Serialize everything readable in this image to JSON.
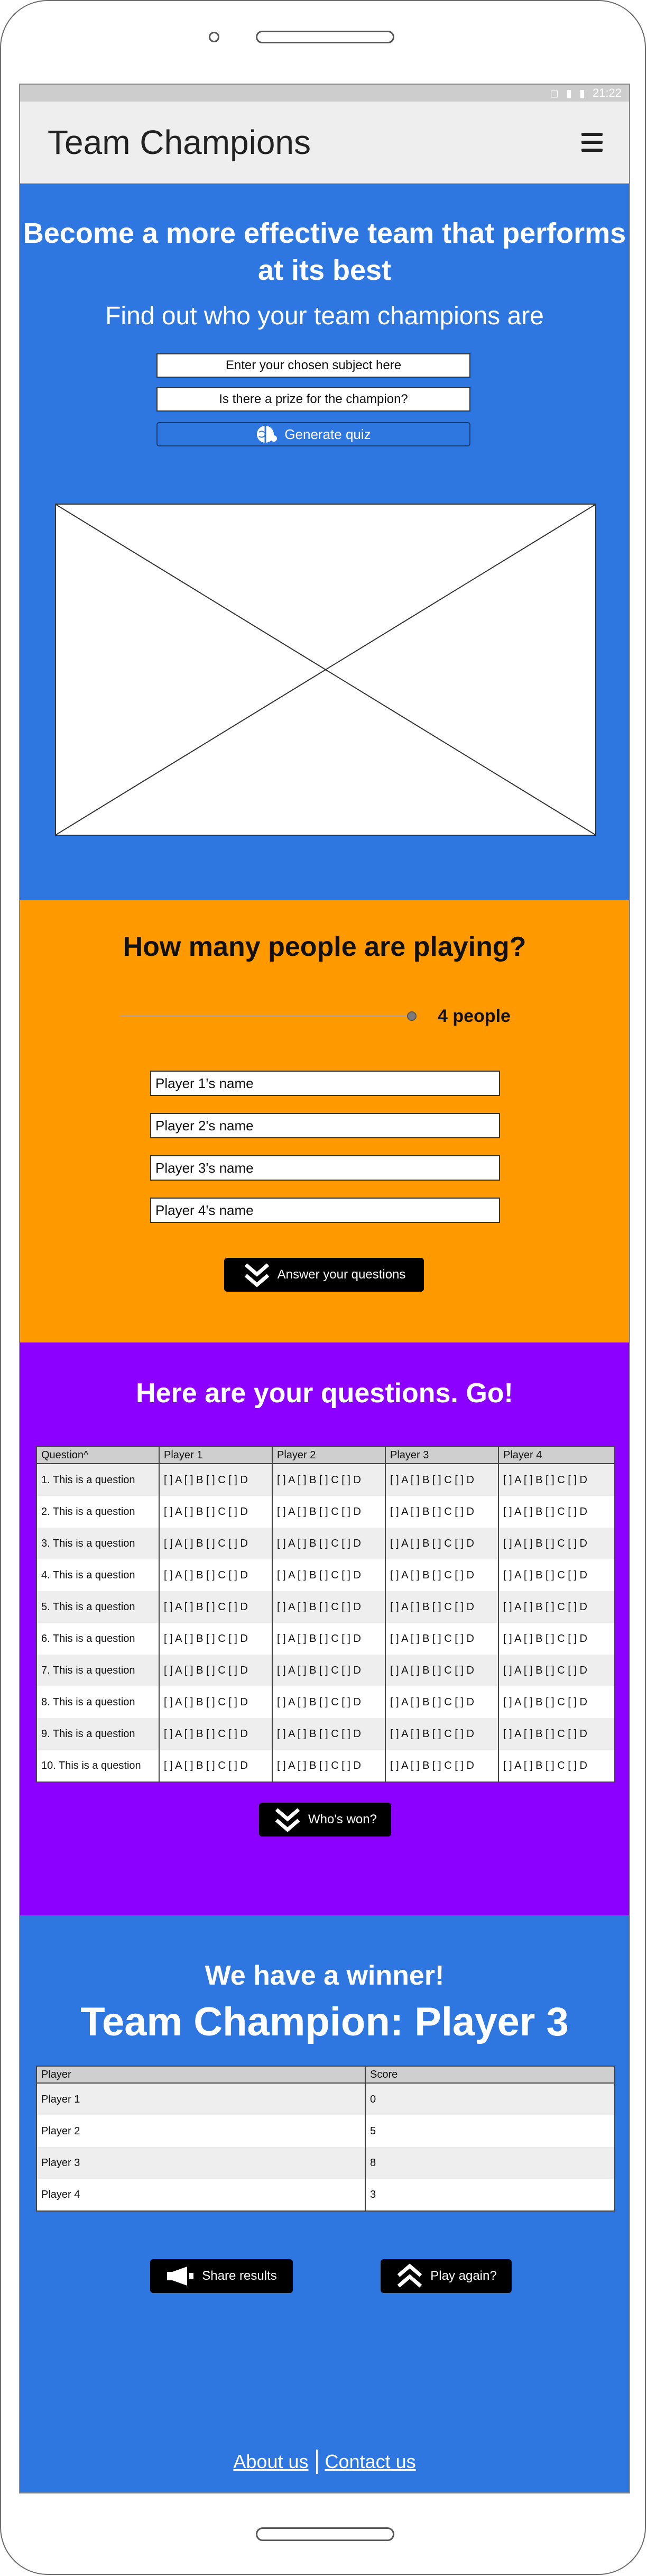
{
  "status_bar": {
    "time": "21:22"
  },
  "header": {
    "title": "Team Champions"
  },
  "hero": {
    "title": "Become a more effective team that performs at its best",
    "subtitle": "Find out who your team champions are",
    "subject_placeholder": "Enter your chosen subject here",
    "prize_placeholder": "Is there a prize for the champion?",
    "generate_label": "Generate quiz"
  },
  "players_section": {
    "title": "How many people are playing?",
    "people_count": "4 people",
    "slider_value": 4,
    "slider_max": 4,
    "name_placeholders": [
      "Player 1's name",
      "Player 2's name",
      "Player 3's name",
      "Player 4's name"
    ],
    "answer_label": "Answer your questions"
  },
  "questions_section": {
    "title": "Here are your questions. Go!",
    "headers": [
      "Question^",
      "Player 1",
      "Player 2",
      "Player 3",
      "Player 4"
    ],
    "rows": [
      [
        "1. This is a question",
        "[ ] A [ ] B [ ] C [ ] D",
        "[ ] A [ ] B [ ] C [ ] D",
        "[ ] A [ ] B [ ] C [ ] D",
        "[ ] A [ ] B [ ] C [ ] D"
      ],
      [
        "2. This is a question",
        "[ ] A [ ] B [ ] C [ ] D",
        "[ ] A [ ] B [ ] C [ ] D",
        "[ ] A [ ] B [ ] C [ ] D",
        "[ ] A [ ] B [ ] C [ ] D"
      ],
      [
        "3. This is a question",
        "[ ] A [ ] B [ ] C [ ] D",
        "[ ] A [ ] B [ ] C [ ] D",
        "[ ] A [ ] B [ ] C [ ] D",
        "[ ] A [ ] B [ ] C [ ] D"
      ],
      [
        "4. This is a question",
        "[ ] A [ ] B [ ] C [ ] D",
        "[ ] A [ ] B [ ] C [ ] D",
        "[ ] A [ ] B [ ] C [ ] D",
        "[ ] A [ ] B [ ] C [ ] D"
      ],
      [
        "5. This is a question",
        "[ ] A [ ] B [ ] C [ ] D",
        "[ ] A [ ] B [ ] C [ ] D",
        "[ ] A [ ] B [ ] C [ ] D",
        "[ ] A [ ] B [ ] C [ ] D"
      ],
      [
        "6. This is a question",
        "[ ] A [ ] B [ ] C [ ] D",
        "[ ] A [ ] B [ ] C [ ] D",
        "[ ] A [ ] B [ ] C [ ] D",
        "[ ] A [ ] B [ ] C [ ] D"
      ],
      [
        "7. This is a question",
        "[ ] A [ ] B [ ] C [ ] D",
        "[ ] A [ ] B [ ] C [ ] D",
        "[ ] A [ ] B [ ] C [ ] D",
        "[ ] A [ ] B [ ] C [ ] D"
      ],
      [
        "8. This is a question",
        "[ ] A [ ] B [ ] C [ ] D",
        "[ ] A [ ] B [ ] C [ ] D",
        "[ ] A [ ] B [ ] C [ ] D",
        "[ ] A [ ] B [ ] C [ ] D"
      ],
      [
        "9. This is a question",
        "[ ] A [ ] B [ ] C [ ] D",
        "[ ] A [ ] B [ ] C [ ] D",
        "[ ] A [ ] B [ ] C [ ] D",
        "[ ] A [ ] B [ ] C [ ] D"
      ],
      [
        "10. This is a question",
        "[ ] A [ ] B [ ] C [ ] D",
        "[ ] A [ ] B [ ] C [ ] D",
        "[ ] A [ ] B [ ] C [ ] D",
        "[ ] A [ ] B [ ] C [ ] D"
      ]
    ],
    "whos_won_label": "Who's won?"
  },
  "results_section": {
    "subtitle": "We have a winner!",
    "title": "Team Champion: Player 3",
    "headers": [
      "Player",
      "Score"
    ],
    "rows": [
      [
        "Player 1",
        "0"
      ],
      [
        "Player 2",
        "5"
      ],
      [
        "Player 3",
        "8"
      ],
      [
        "Player 4",
        "3"
      ]
    ],
    "share_label": "Share results",
    "play_again_label": "Play again?"
  },
  "footer": {
    "about_label": "About us",
    "contact_label": "Contact us"
  },
  "colors": {
    "blue": "#2f77e0",
    "orange": "#ff9900",
    "purple": "#8b00ff",
    "black": "#000000"
  }
}
